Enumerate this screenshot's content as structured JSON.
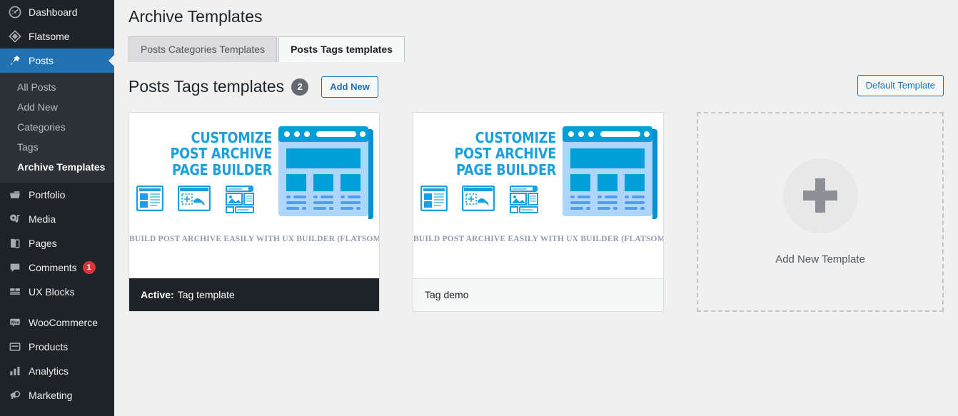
{
  "colors": {
    "sidebar_bg": "#1d2327",
    "submenu_bg": "#2c3338",
    "accent_blue": "#2271b1",
    "illustration_blue": "#1ba0dd",
    "badge_red": "#d63638",
    "page_bg": "#f0f0f1"
  },
  "sidebar": {
    "items": [
      {
        "label": "Dashboard",
        "icon": "dashboard-icon",
        "current": false
      },
      {
        "label": "Flatsome",
        "icon": "flatsome-diamond-icon",
        "current": false
      },
      {
        "label": "Posts",
        "icon": "pin-icon",
        "current": true
      },
      {
        "label": "Portfolio",
        "icon": "portfolio-folder-icon",
        "current": false
      },
      {
        "label": "Media",
        "icon": "media-icon",
        "current": false
      },
      {
        "label": "Pages",
        "icon": "pages-icon",
        "current": false
      },
      {
        "label": "Comments",
        "icon": "comment-bubble-icon",
        "current": false,
        "badge": "1"
      },
      {
        "label": "UX Blocks",
        "icon": "ux-blocks-icon",
        "current": false
      },
      {
        "label": "WooCommerce",
        "icon": "woocommerce-icon",
        "current": false
      },
      {
        "label": "Products",
        "icon": "products-icon",
        "current": false
      },
      {
        "label": "Analytics",
        "icon": "analytics-bars-icon",
        "current": false
      },
      {
        "label": "Marketing",
        "icon": "megaphone-icon",
        "current": false
      }
    ],
    "posts_submenu": [
      {
        "label": "All Posts",
        "current": false
      },
      {
        "label": "Add New",
        "current": false
      },
      {
        "label": "Categories",
        "current": false
      },
      {
        "label": "Tags",
        "current": false
      },
      {
        "label": "Archive Templates",
        "current": true
      }
    ]
  },
  "header": {
    "title": "Archive Templates"
  },
  "tabs": [
    {
      "label": "Posts Categories Templates",
      "active": false
    },
    {
      "label": "Posts Tags templates",
      "active": true
    }
  ],
  "toolbar": {
    "section_title": "Posts Tags templates",
    "count": "2",
    "add_new_label": "Add New",
    "default_template_label": "Default Template"
  },
  "thumbnail": {
    "headline_line1": "CUSTOMIZE",
    "headline_line2": "POST ARCHIVE",
    "headline_line3": "PAGE BUILDER",
    "caption": "BUILD POST ARCHIVE EASILY WITH UX BUILDER (FLATSOME)"
  },
  "templates": [
    {
      "name": "Tag template",
      "active": true,
      "active_prefix": "Active:"
    },
    {
      "name": "Tag demo",
      "active": false,
      "active_prefix": ""
    }
  ],
  "add_placeholder": {
    "label": "Add New Template",
    "icon": "plus-icon"
  }
}
